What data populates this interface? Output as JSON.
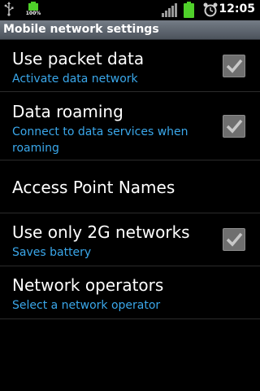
{
  "status_bar": {
    "battery_small_label": "100%",
    "time": "12:05",
    "icons": [
      "usb-icon",
      "battery-icon",
      "signal-icon",
      "battery-icon",
      "alarm-clock-icon"
    ]
  },
  "header": {
    "title": "Mobile network settings"
  },
  "settings": {
    "items": [
      {
        "title": "Use packet data",
        "summary": "Activate data network",
        "checked": true
      },
      {
        "title": "Data roaming",
        "summary": "Connect to data services when roaming",
        "checked": true
      },
      {
        "title": "Access Point Names"
      },
      {
        "title": "Use only 2G networks",
        "summary": "Saves battery",
        "checked": true
      },
      {
        "title": "Network operators",
        "summary": "Select a network operator"
      }
    ]
  },
  "colors": {
    "summary_text": "#3aa7ea",
    "battery_green": "#4fd02a",
    "title_bar": "#5f6770"
  }
}
